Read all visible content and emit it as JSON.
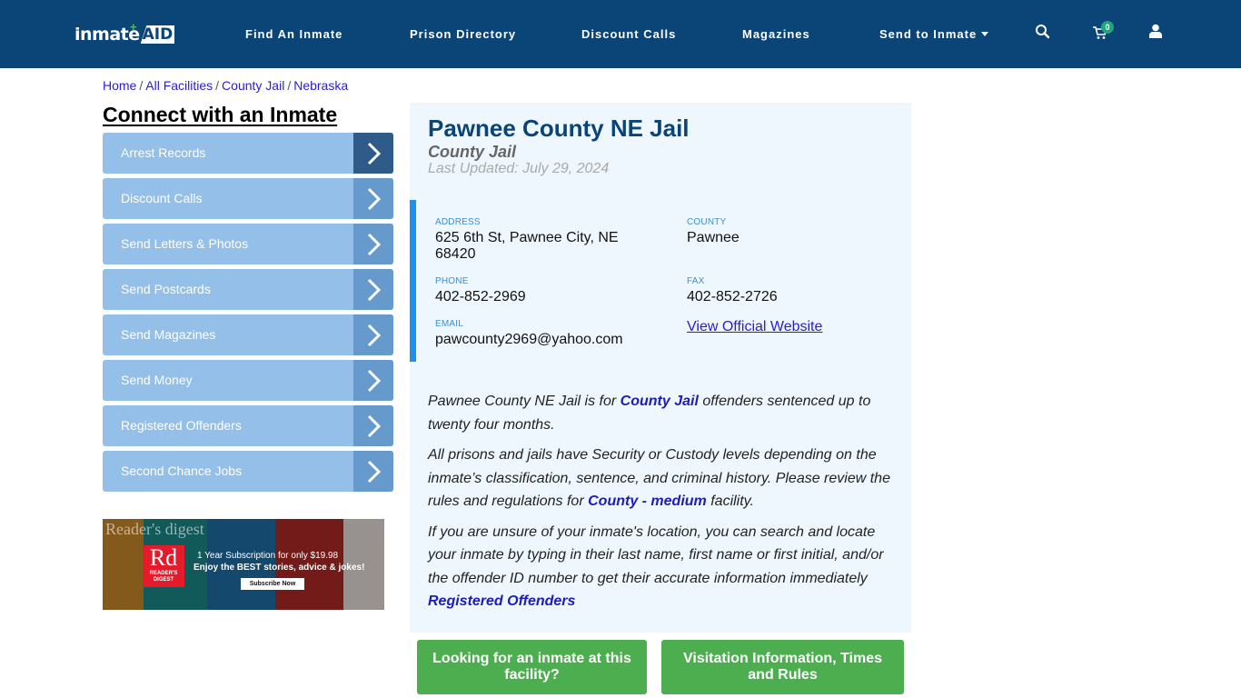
{
  "header": {
    "logo_text": "inmate",
    "logo_badge": "AID",
    "nav": [
      {
        "label": "Find An Inmate"
      },
      {
        "label": "Prison Directory"
      },
      {
        "label": "Discount Calls"
      },
      {
        "label": "Magazines"
      },
      {
        "label": "Send to Inmate"
      }
    ],
    "cart_count": "0",
    "icons": {
      "search": "search-icon",
      "cart": "cart-icon",
      "user": "user-icon"
    }
  },
  "breadcrumb": [
    {
      "label": "Home"
    },
    {
      "label": "All Facilities"
    },
    {
      "label": "County Jail"
    },
    {
      "label": "Nebraska"
    }
  ],
  "breadcrumb_sep": "/",
  "sidebar": {
    "title": "Connect with an Inmate",
    "items": [
      {
        "label": "Arrest Records"
      },
      {
        "label": "Discount Calls"
      },
      {
        "label": "Send Letters & Photos"
      },
      {
        "label": "Send Postcards"
      },
      {
        "label": "Send Magazines"
      },
      {
        "label": "Send Money"
      },
      {
        "label": "Registered Offenders"
      },
      {
        "label": "Second Chance Jobs"
      }
    ],
    "ad": {
      "brand": "Rd",
      "brand_sub": "READER'S DIGEST",
      "line1": "1 Year Subscription for only $19.98",
      "line2": "Enjoy the BEST stories, advice & jokes!",
      "cta": "Subscribe Now",
      "cover_title": "Reader's digest"
    }
  },
  "facility": {
    "name": "Pawnee County NE Jail",
    "type": "County Jail",
    "last_updated": "Last Updated: July 29, 2024",
    "address_label": "ADDRESS",
    "address": "625 6th St, Pawnee City, NE 68420",
    "county_label": "COUNTY",
    "county": "Pawnee",
    "phone_label": "PHONE",
    "phone": "402-852-2969",
    "fax_label": "FAX",
    "fax": "402-852-2726",
    "email_label": "EMAIL",
    "email": "pawcounty2969@yahoo.com",
    "website_link": "View Official Website"
  },
  "description": {
    "p1_a": "Pawnee County NE Jail is for ",
    "p1_link": "County Jail",
    "p1_b": " offenders sentenced up to twenty four months.",
    "p2_a": "All prisons and jails have Security or Custody levels depending on the inmate’s classification, sentence, and criminal history. Please review the rules and regulations for ",
    "p2_link": "County - medium",
    "p2_b": " facility.",
    "p3": "If you are unsure of your inmate's location, you can search and locate your inmate by typing in their last name, first name or first initial, and/or the offender ID number to get their accurate information immediately",
    "p3_link": "Registered Offenders"
  },
  "buttons": {
    "find_inmate": "Looking for an inmate at this facility?",
    "visitation": "Visitation Information, Times and Rules"
  }
}
